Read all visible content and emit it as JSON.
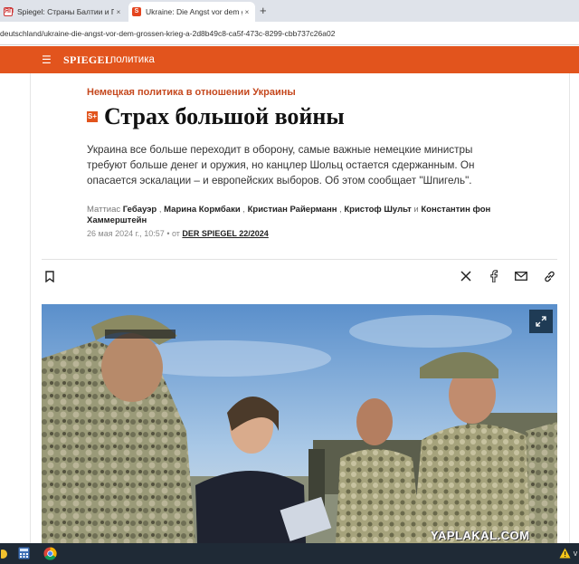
{
  "browser": {
    "tabs": [
      {
        "title": "Spiegel: Страны Балтии и Поль",
        "favicon": "yaplakal-favicon"
      },
      {
        "title": "Ukraine: Die Angst vor dem gro",
        "favicon": "spiegel-favicon",
        "favicon_letter": "S"
      }
    ],
    "new_tab_label": "+",
    "close_label": "×",
    "url": "deutschland/ukraine-die-angst-vor-dem-grossen-krieg-a-2d8b49c8-ca5f-473c-8299-cbb737c26a02"
  },
  "site": {
    "logo": "SPIEGEL",
    "section": "политика",
    "brand_color": "#e2541d"
  },
  "article": {
    "kicker": "Немецкая политика в отношении Украины",
    "plus_badge": "S+",
    "title": "Страх большой войны",
    "lead": "Украина все больше переходит в оборону, самые важные немецкие министры требуют больше денег и оружия, но канцлер Шольц остается сдержанным. Он опасается эскалации – и европейских выборов. Об этом сообщает \"Шпигель\".",
    "byline": {
      "prefix": "Маттиас ",
      "authors": [
        "Гебауэр",
        "Марина Кормбаки",
        "Кристиан Райерманн",
        "Кристоф Шульт",
        "Константин фон Хаммерштейн"
      ],
      "separator": " , ",
      "conjunction": " и "
    },
    "date": "26 мая 2024 г., 10:57",
    "dot": " • от ",
    "source": "DER SPIEGEL 22/2024"
  },
  "share": {
    "icons": [
      "bookmark-icon",
      "x-icon",
      "facebook-icon",
      "mail-icon",
      "link-icon"
    ]
  },
  "photo": {
    "expand_icon": "expand-icon",
    "watermark": "YAPLAKAL.COM"
  },
  "taskbar": {
    "icons": [
      "chrome-icon",
      "calculator-icon",
      "warning-icon"
    ]
  }
}
